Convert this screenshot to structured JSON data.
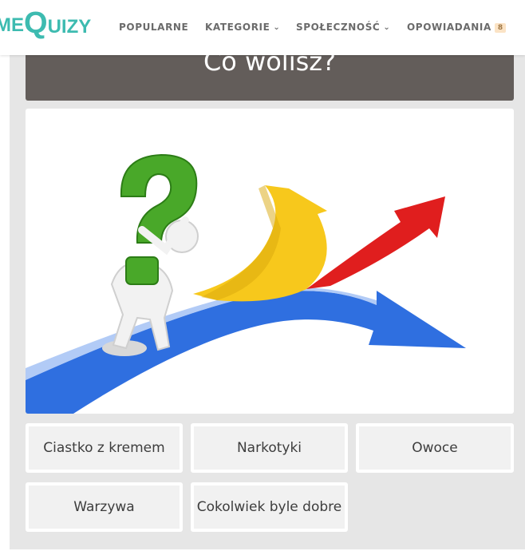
{
  "logo": {
    "part1": "ME",
    "part2": "Q",
    "part3": "UIZY"
  },
  "nav": {
    "popularne": "POPULARNE",
    "kategorie": "KATEGORIE",
    "spolecznosc": "SPOŁECZNOŚĆ",
    "opowiadania": "OPOWIADANIA",
    "opowiadania_badge": "8",
    "chevron": "⌄"
  },
  "question": {
    "title": "Co wolisz?",
    "image_icon": "decision-arrows-illustration"
  },
  "answers": [
    {
      "label": "Ciastko z kremem"
    },
    {
      "label": "Narkotyki"
    },
    {
      "label": "Owoce"
    },
    {
      "label": "Warzywa"
    },
    {
      "label": "Cokolwiek byle dobre"
    }
  ],
  "colors": {
    "brand": "#3dbbb0",
    "header_bg": "#635d5a",
    "panel_bg": "#e6e6e6",
    "answer_bg": "#f1f1f1"
  }
}
